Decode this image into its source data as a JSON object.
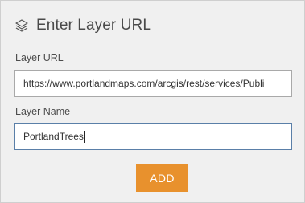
{
  "panel": {
    "title": "Enter Layer URL",
    "title_icon": "layers-icon"
  },
  "form": {
    "url_label": "Layer URL",
    "url_value": "https://www.portlandmaps.com/arcgis/rest/services/Publi",
    "name_label": "Layer Name",
    "name_value": "PortlandTrees"
  },
  "actions": {
    "add_label": "ADD"
  },
  "colors": {
    "accent": "#e8912d",
    "panel_bg": "#f0f0f0",
    "focused_border": "#5a7fa8"
  }
}
